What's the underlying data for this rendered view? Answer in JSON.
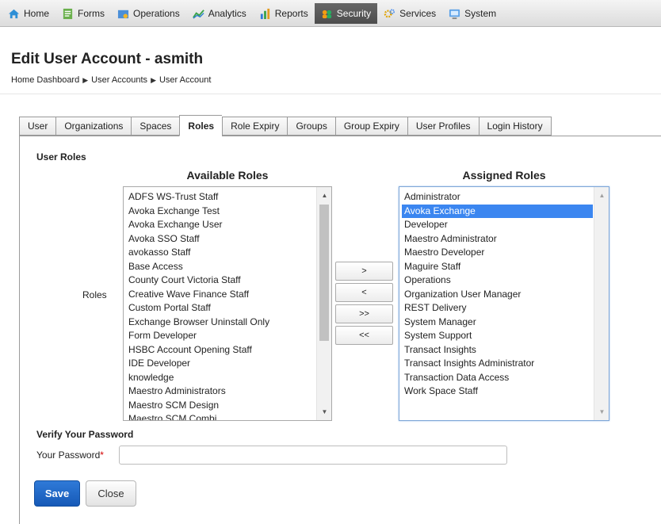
{
  "nav": {
    "items": [
      {
        "label": "Home",
        "icon": "home-icon"
      },
      {
        "label": "Forms",
        "icon": "forms-icon"
      },
      {
        "label": "Operations",
        "icon": "operations-icon"
      },
      {
        "label": "Analytics",
        "icon": "analytics-icon"
      },
      {
        "label": "Reports",
        "icon": "reports-icon"
      },
      {
        "label": "Security",
        "icon": "security-icon",
        "active": true
      },
      {
        "label": "Services",
        "icon": "services-icon"
      },
      {
        "label": "System",
        "icon": "system-icon"
      }
    ]
  },
  "page": {
    "title": "Edit User Account - asmith",
    "breadcrumb": [
      "Home Dashboard",
      "User Accounts",
      "User Account"
    ]
  },
  "tabs": [
    {
      "label": "User"
    },
    {
      "label": "Organizations"
    },
    {
      "label": "Spaces"
    },
    {
      "label": "Roles",
      "active": true
    },
    {
      "label": "Role Expiry"
    },
    {
      "label": "Groups"
    },
    {
      "label": "Group Expiry"
    },
    {
      "label": "User Profiles"
    },
    {
      "label": "Login History"
    }
  ],
  "roles": {
    "section_title": "User Roles",
    "field_label": "Roles",
    "available_title": "Available Roles",
    "assigned_title": "Assigned Roles",
    "available": [
      "ADFS WS-Trust Staff",
      "Avoka Exchange Test",
      "Avoka Exchange User",
      "Avoka SSO Staff",
      "avokasso Staff",
      "Base Access",
      "County Court Victoria Staff",
      "Creative Wave Finance Staff",
      "Custom Portal Staff",
      "Exchange Browser Uninstall Only",
      "Form Developer",
      "HSBC Account Opening Staff",
      "IDE Developer",
      "knowledge",
      "Maestro Administrators",
      "Maestro SCM Design",
      "Maestro SCM Combi..."
    ],
    "assigned": [
      "Administrator",
      "Avoka Exchange",
      "Developer",
      "Maestro Administrator",
      "Maestro Developer",
      "Maguire Staff",
      "Operations",
      "Organization User Manager",
      "REST Delivery",
      "System Manager",
      "System Support",
      "Transact Insights",
      "Transact Insights Administrator",
      "Transaction Data Access",
      "Work Space Staff"
    ],
    "assigned_selected": "Avoka Exchange",
    "move_buttons": {
      "add": ">",
      "remove": "<",
      "add_all": ">>",
      "remove_all": "<<"
    }
  },
  "password": {
    "section_title": "Verify Your Password",
    "label": "Your Password",
    "required_mark": "*",
    "value": ""
  },
  "actions": {
    "save": "Save",
    "close": "Close"
  },
  "colors": {
    "accent": "#1a62c4",
    "selection": "#3b86f0",
    "active_nav": "#555555"
  }
}
